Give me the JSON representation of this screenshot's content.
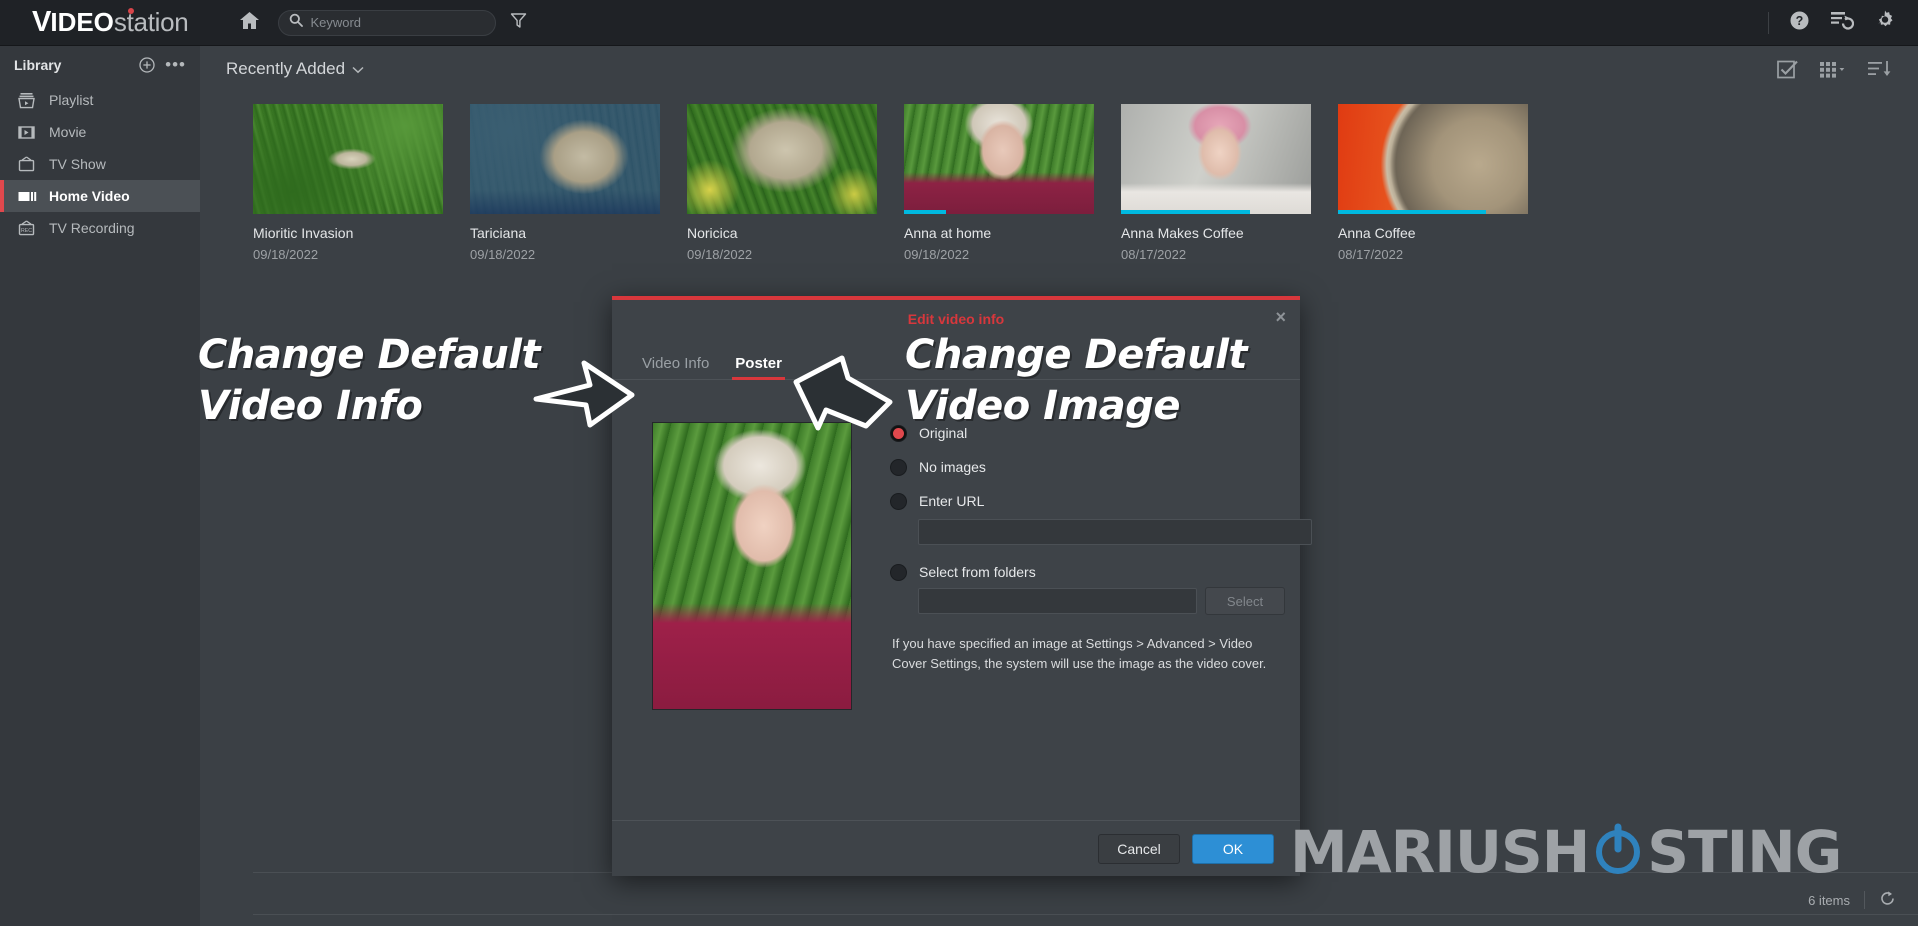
{
  "app": {
    "brand_v": "V",
    "brand_ideo": "IDEO",
    "brand_station": "station",
    "accent_red": "#d8373c",
    "accent_blue": "#2d8fd5",
    "progress_color": "#00b9e0"
  },
  "topbar": {
    "home_label": "Home",
    "search_placeholder": "Keyword",
    "search_value": "",
    "filter_label": "Filter",
    "help_label": "Help",
    "queue_label": "Task queue",
    "settings_label": "Settings"
  },
  "sidebar": {
    "title": "Library",
    "add_label": "Add library",
    "more_label": "More options",
    "items": [
      {
        "label": "Playlist",
        "icon": "playlist-icon",
        "active": false
      },
      {
        "label": "Movie",
        "icon": "movie-icon",
        "active": false
      },
      {
        "label": "TV Show",
        "icon": "tv-show-icon",
        "active": false
      },
      {
        "label": "Home Video",
        "icon": "home-video-icon",
        "active": true
      },
      {
        "label": "TV Recording",
        "icon": "tv-recording-icon",
        "active": false
      }
    ]
  },
  "main": {
    "sort_label": "Recently Added",
    "select_all_label": "Select all",
    "view_grid_label": "Grid view",
    "sort_order_label": "Sort order",
    "items_count": "6 items",
    "refresh_label": "Refresh"
  },
  "videos": [
    {
      "title": "Mioritic Invasion",
      "date": "09/18/2022",
      "thumb": "img-grass1",
      "progress": 0
    },
    {
      "title": "Tariciana",
      "date": "09/18/2022",
      "thumb": "img-dog2",
      "progress": 0
    },
    {
      "title": "Noricica",
      "date": "09/18/2022",
      "thumb": "img-dog3",
      "progress": 0
    },
    {
      "title": "Anna at home",
      "date": "09/18/2022",
      "thumb": "img-anna-out",
      "progress": 22
    },
    {
      "title": "Anna Makes Coffee",
      "date": "08/17/2022",
      "thumb": "img-anna-kitchen",
      "progress": 68
    },
    {
      "title": "Anna Coffee",
      "date": "08/17/2022",
      "thumb": "img-coffee",
      "progress": 78
    }
  ],
  "dialog": {
    "title": "Edit video info",
    "close_label": "×",
    "tabs": [
      {
        "label": "Video Info",
        "active": false
      },
      {
        "label": "Poster",
        "active": true
      }
    ],
    "poster_alt": "Current poster preview",
    "options": [
      {
        "label": "Original",
        "selected": true
      },
      {
        "label": "No images",
        "selected": false
      },
      {
        "label": "Enter URL",
        "selected": false
      },
      {
        "label": "Select from folders",
        "selected": false
      }
    ],
    "url_value": "",
    "folder_value": "",
    "select_button": "Select",
    "hint": "If you have specified an image at Settings > Advanced > Video Cover Settings, the system will use the image as the video cover.",
    "cancel_label": "Cancel",
    "ok_label": "OK"
  },
  "annotations": [
    {
      "text": "Change Default\nVideo Info",
      "position": "left"
    },
    {
      "text": "Change Default\nVideo Image",
      "position": "right"
    }
  ],
  "watermark": {
    "part1": "MARIUSH",
    "part2": "STING"
  }
}
